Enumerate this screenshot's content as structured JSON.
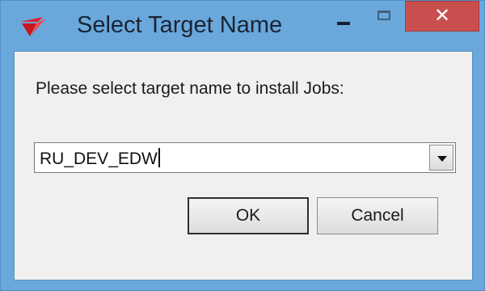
{
  "window": {
    "title": "Select Target Name",
    "close_symbol": "✕",
    "icons": {
      "app": "app-logo-icon",
      "minimize": "minimize-icon",
      "maximize": "maximize-icon",
      "close": "close-icon"
    },
    "colors": {
      "frame": "#6aa8dc",
      "close_button": "#c94f4f",
      "client": "#f0f0f0"
    }
  },
  "dialog": {
    "prompt": "Please select target name to install Jobs:",
    "target_select": {
      "value": "RU_DEV_EDW"
    },
    "ok_label": "OK",
    "cancel_label": "Cancel"
  }
}
